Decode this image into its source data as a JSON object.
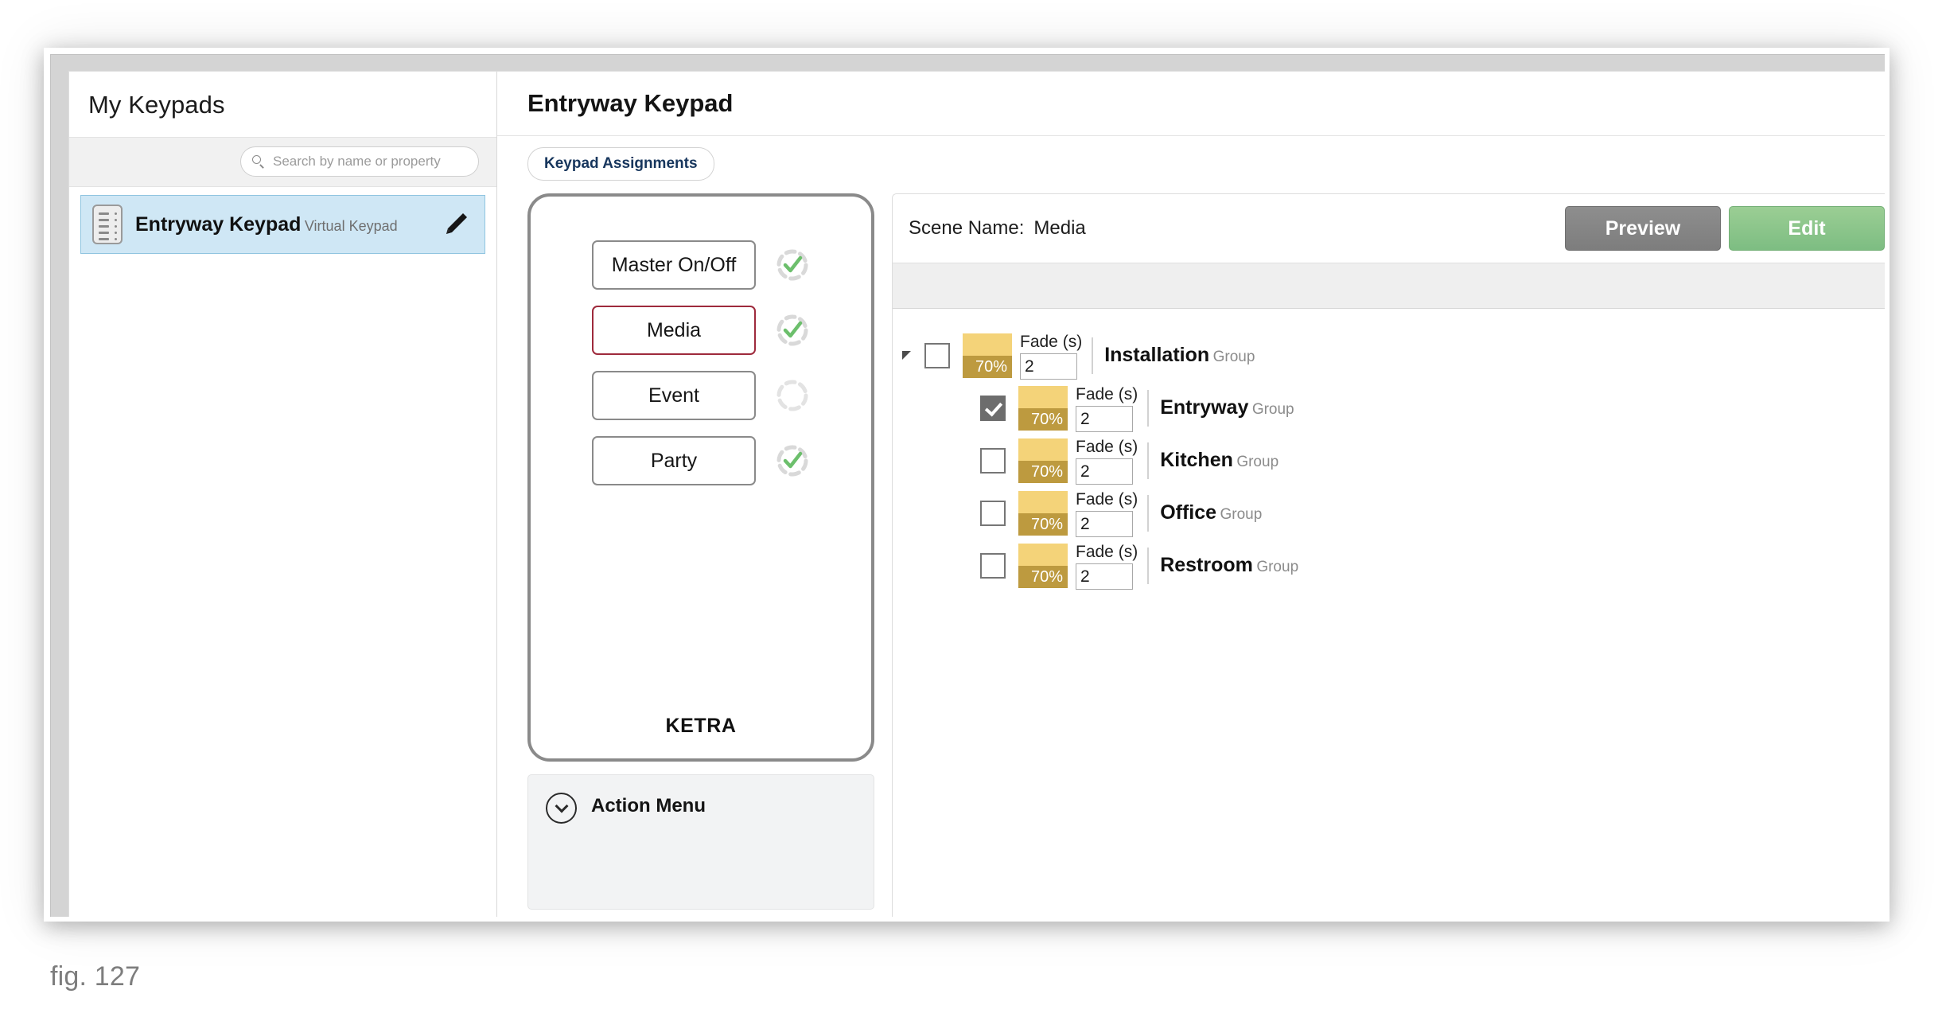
{
  "figure": {
    "caption": "fig. 127"
  },
  "sidebar": {
    "title": "My Keypads",
    "search": {
      "placeholder": "Search by name or property",
      "value": ""
    },
    "items": [
      {
        "name": "Entryway Keypad",
        "subtitle": "Virtual Keypad",
        "selected": true
      }
    ]
  },
  "main": {
    "title": "Entryway Keypad",
    "tabs": [
      {
        "label": "Keypad Assignments",
        "active": true
      }
    ]
  },
  "device": {
    "brand": "KETRA",
    "buttons": [
      {
        "label": "Master On/Off",
        "selected": false,
        "status": "checked"
      },
      {
        "label": "Media",
        "selected": true,
        "status": "checked"
      },
      {
        "label": "Event",
        "selected": false,
        "status": "empty"
      },
      {
        "label": "Party",
        "selected": false,
        "status": "checked"
      }
    ],
    "action_menu": {
      "label": "Action Menu",
      "expanded": false
    }
  },
  "scene": {
    "name_label": "Scene Name:",
    "name_value": "Media",
    "preview_label": "Preview",
    "edit_label": "Edit",
    "fade_label": "Fade (s)",
    "rows": [
      {
        "name": "Installation",
        "type": "Group",
        "level": 0,
        "checked": false,
        "expanded": true,
        "level_pct": "70%",
        "fade": "2"
      },
      {
        "name": "Entryway",
        "type": "Group",
        "level": 1,
        "checked": true,
        "expanded": false,
        "level_pct": "70%",
        "fade": "2"
      },
      {
        "name": "Kitchen",
        "type": "Group",
        "level": 1,
        "checked": false,
        "expanded": false,
        "level_pct": "70%",
        "fade": "2"
      },
      {
        "name": "Office",
        "type": "Group",
        "level": 1,
        "checked": false,
        "expanded": false,
        "level_pct": "70%",
        "fade": "2"
      },
      {
        "name": "Restroom",
        "type": "Group",
        "level": 1,
        "checked": false,
        "expanded": false,
        "level_pct": "70%",
        "fade": "2"
      }
    ]
  },
  "colors": {
    "selection_blue": "#cfe7f5",
    "selected_button_red": "#9e2a3c",
    "swatch_light": "#f4d379",
    "swatch_dark": "#bd9a3f",
    "preview_gray": "#7d7d7d",
    "edit_green": "#7dbd82",
    "status_green": "#6cbf6c"
  }
}
